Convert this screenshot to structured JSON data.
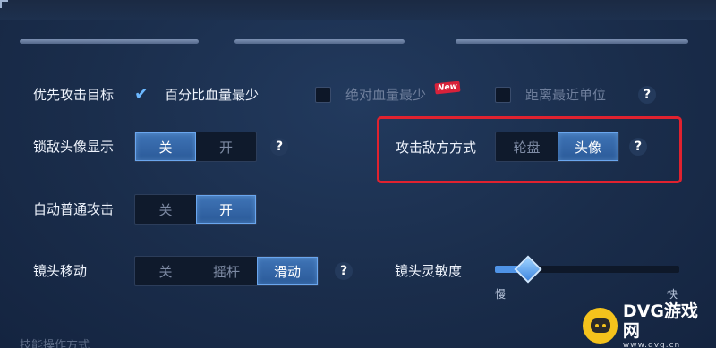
{
  "target_priority": {
    "label": "优先攻击目标",
    "options": [
      {
        "label": "百分比血量最少",
        "checked": true,
        "enabled": true
      },
      {
        "label": "绝对血量最少",
        "checked": false,
        "enabled": false,
        "badge": "New"
      },
      {
        "label": "距离最近单位",
        "checked": false,
        "enabled": false
      }
    ],
    "help": "?"
  },
  "lock_portrait": {
    "label": "锁敌头像显示",
    "options": [
      "关",
      "开"
    ],
    "selected": "关",
    "help": "?"
  },
  "attack_method": {
    "label": "攻击敌方方式",
    "options": [
      "轮盘",
      "头像"
    ],
    "selected": "头像",
    "help": "?"
  },
  "auto_attack": {
    "label": "自动普通攻击",
    "options": [
      "关",
      "开"
    ],
    "selected": "开"
  },
  "camera_move": {
    "label": "镜头移动",
    "options": [
      "关",
      "摇杆",
      "滑动"
    ],
    "selected": "滑动",
    "help": "?"
  },
  "camera_sensitivity": {
    "label": "镜头灵敏度",
    "min_label": "慢",
    "max_label": "快",
    "level": 0.18
  },
  "footer_partial": "技能操作方式",
  "watermark": {
    "title": "DVG游戏网",
    "subtitle": "www.dvg.cn"
  },
  "colors": {
    "accent": "#4f93e6",
    "highlight": "#e0222f"
  }
}
